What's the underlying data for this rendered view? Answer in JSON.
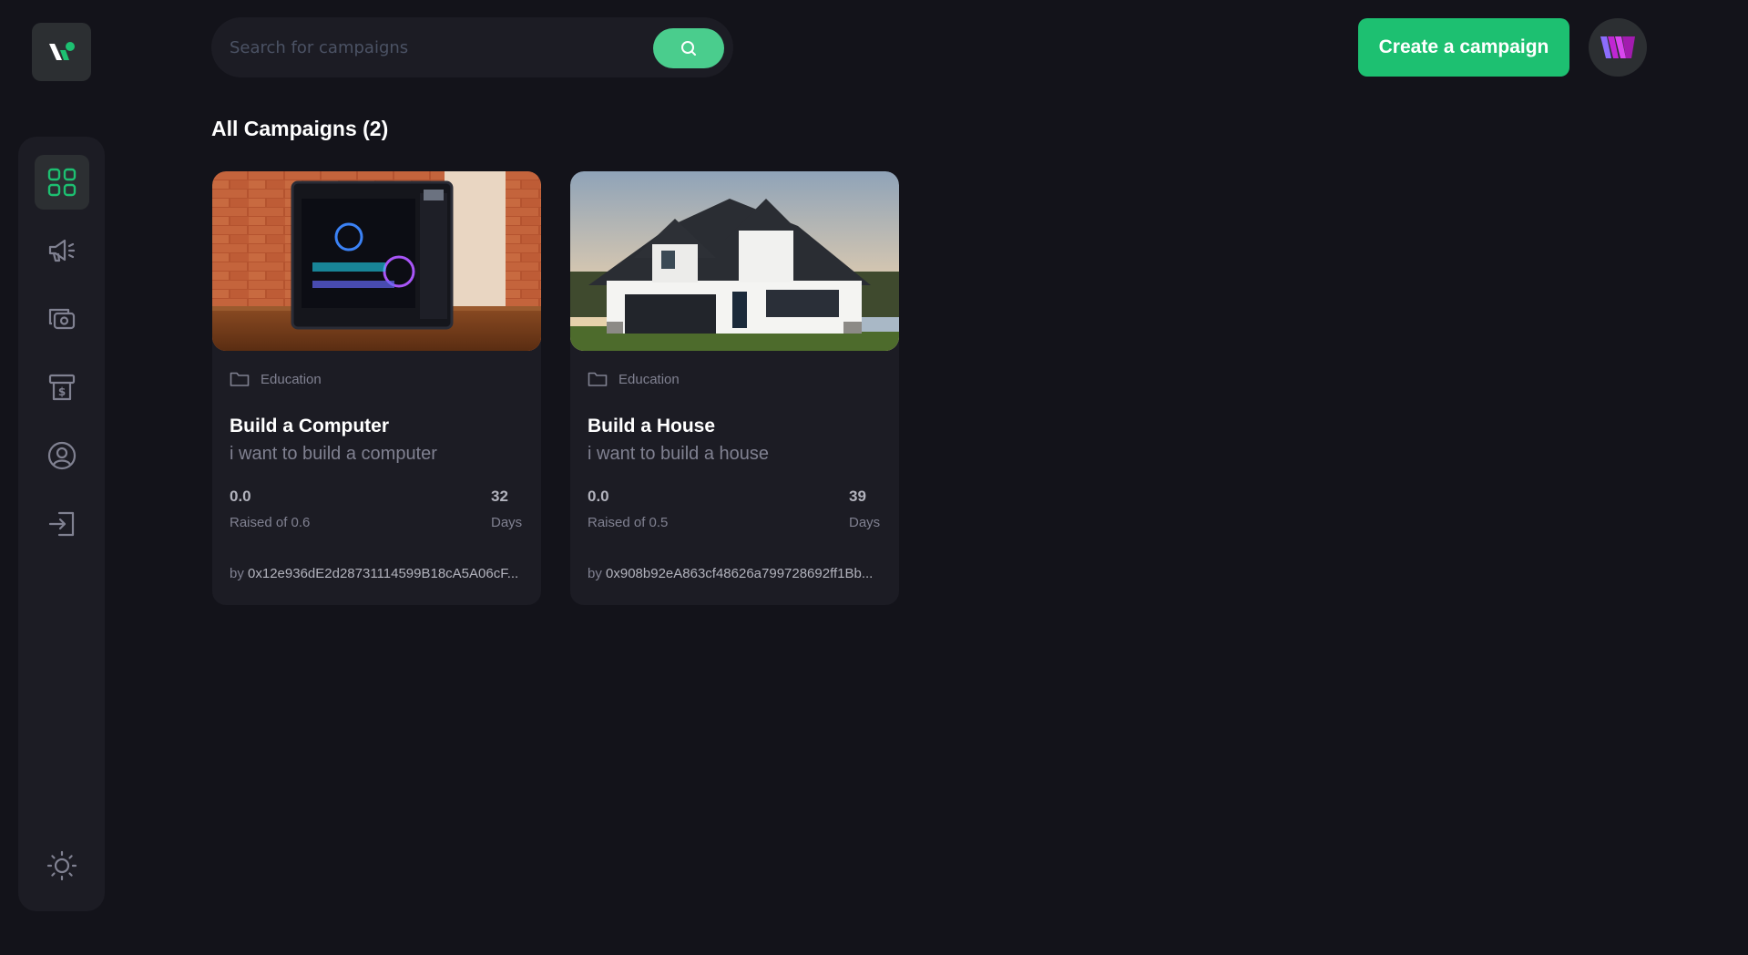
{
  "nav": {
    "items": [
      {
        "icon": "dashboard-icon",
        "active": true
      },
      {
        "icon": "megaphone-icon",
        "active": false
      },
      {
        "icon": "payment-icon",
        "active": false
      },
      {
        "icon": "withdraw-icon",
        "active": false
      },
      {
        "icon": "profile-icon",
        "active": false
      },
      {
        "icon": "logout-icon",
        "active": false
      }
    ],
    "theme_icon": "sun-icon"
  },
  "header": {
    "search_placeholder": "Search for campaigns",
    "create_label": "Create a campaign"
  },
  "main": {
    "title": "All Campaigns (2)",
    "campaigns": [
      {
        "category": "Education",
        "title": "Build a Computer",
        "description": "i want to build a computer",
        "raised": "0.0",
        "raised_label": "Raised of 0.6",
        "days": "32",
        "days_label": "Days",
        "by": "by",
        "owner": "0x12e936dE2d28731114599B18cA5A06cF..."
      },
      {
        "category": "Education",
        "title": "Build a House",
        "description": "i want to build a house",
        "raised": "0.0",
        "raised_label": "Raised of 0.5",
        "days": "39",
        "days_label": "Days",
        "by": "by",
        "owner": "0x908b92eA863cf48626a799728692ff1Bb..."
      }
    ]
  },
  "colors": {
    "background": "#13131a",
    "panel": "#1c1c24",
    "accent": "#1dc071",
    "search_button": "#4acd8d",
    "muted_text": "#808191"
  }
}
